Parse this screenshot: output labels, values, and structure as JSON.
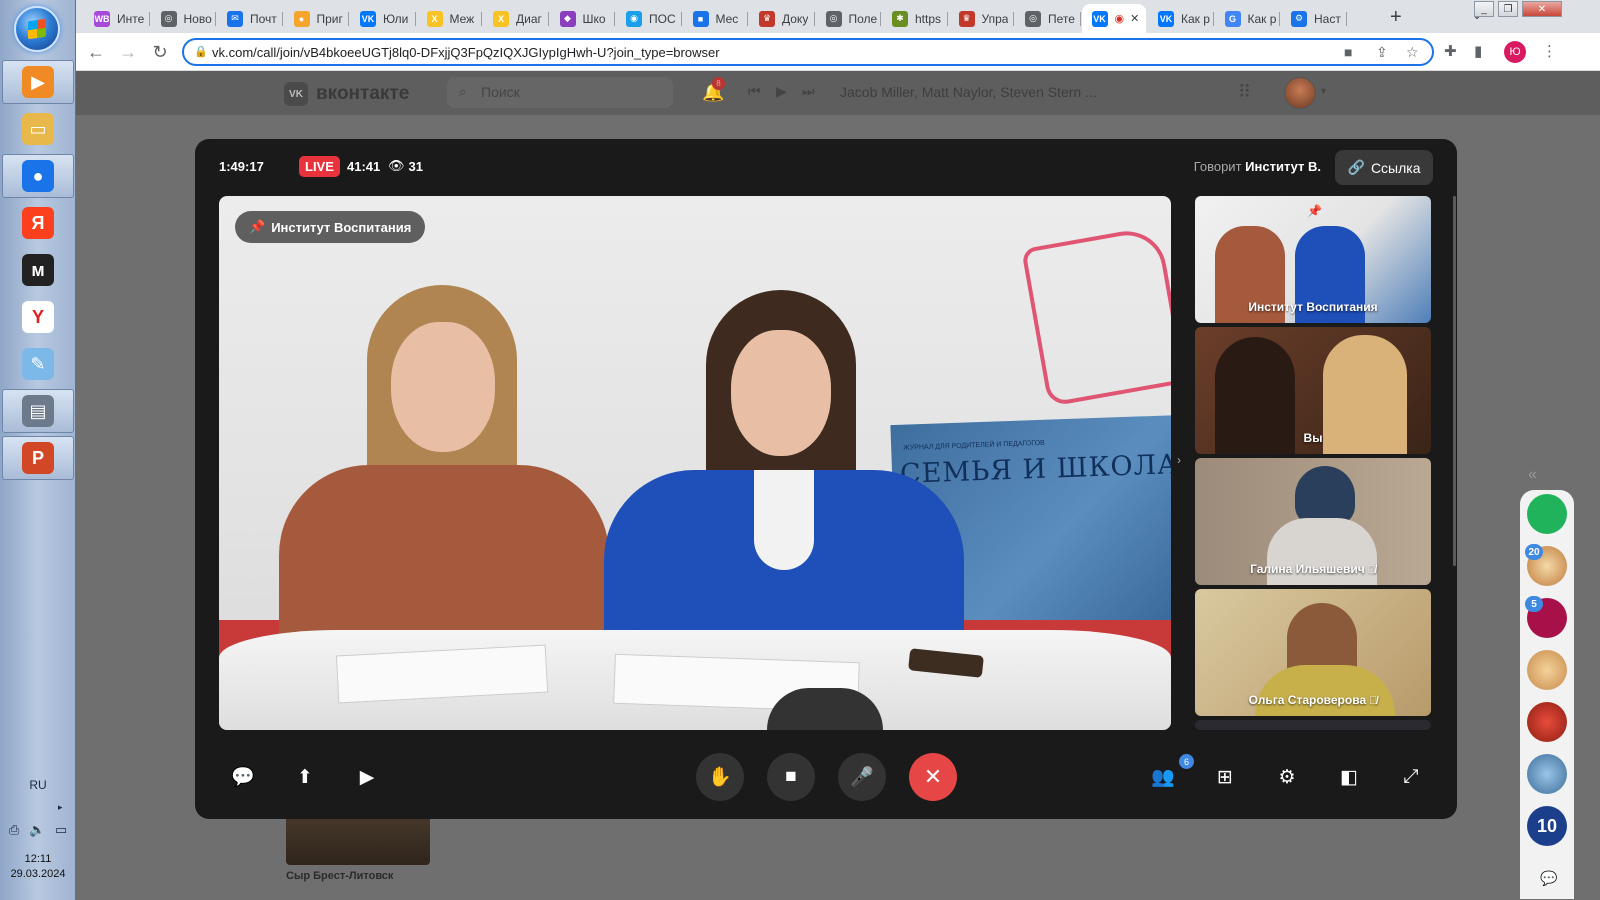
{
  "taskbar": {
    "language": "RU",
    "tray_arrow": "▸",
    "time": "12:11",
    "date": "29.03.2024",
    "apps": [
      {
        "name": "media-player",
        "color": "#f08a24",
        "glyph": "▶"
      },
      {
        "name": "file-explorer",
        "color": "#e8b84a",
        "glyph": "▭"
      },
      {
        "name": "chrome",
        "color": "#1a73e8",
        "glyph": "●"
      },
      {
        "name": "yandex",
        "color": "#fc3f1d",
        "glyph": "Я"
      },
      {
        "name": "yandex-music",
        "color": "#222",
        "glyph": "м"
      },
      {
        "name": "yandex-browser",
        "color": "#fff",
        "glyph": "Y"
      },
      {
        "name": "paint",
        "color": "#7cb9e8",
        "glyph": "✎"
      },
      {
        "name": "scanner",
        "color": "#6d7a8c",
        "glyph": "▤"
      },
      {
        "name": "powerpoint",
        "color": "#d24726",
        "glyph": "P"
      }
    ]
  },
  "browser": {
    "tabs": [
      {
        "title": "Инте",
        "favicon_color": "#a64bd9",
        "favicon_glyph": "WB"
      },
      {
        "title": "Ново",
        "favicon_color": "#5f6368",
        "favicon_glyph": "◎"
      },
      {
        "title": "Почт",
        "favicon_color": "#1a73e8",
        "favicon_glyph": "✉"
      },
      {
        "title": "Приг",
        "favicon_color": "#f4a52b",
        "favicon_glyph": "●"
      },
      {
        "title": "Юли",
        "favicon_color": "#0077ff",
        "favicon_glyph": "VK"
      },
      {
        "title": "Меж",
        "favicon_color": "#f7c325",
        "favicon_glyph": "Х"
      },
      {
        "title": "Диаг",
        "favicon_color": "#f7c325",
        "favicon_glyph": "Х"
      },
      {
        "title": "Шко",
        "favicon_color": "#8b3fbf",
        "favicon_glyph": "◆"
      },
      {
        "title": "ПОС",
        "favicon_color": "#1aa0e8",
        "favicon_glyph": "◉"
      },
      {
        "title": "Мес",
        "favicon_color": "#1a73e8",
        "favicon_glyph": "■"
      },
      {
        "title": "Доку",
        "favicon_color": "#c0392b",
        "favicon_glyph": "♛"
      },
      {
        "title": "Поле",
        "favicon_color": "#5f6368",
        "favicon_glyph": "◎"
      },
      {
        "title": "https",
        "favicon_color": "#6b8e23",
        "favicon_glyph": "✱"
      },
      {
        "title": "Упра",
        "favicon_color": "#c0392b",
        "favicon_glyph": "♛"
      },
      {
        "title": "Пете",
        "favicon_color": "#5f6368",
        "favicon_glyph": "◎"
      },
      {
        "title": "",
        "favicon_color": "#0077ff",
        "favicon_glyph": "VK",
        "active": true
      },
      {
        "title": "Как р",
        "favicon_color": "#0077ff",
        "favicon_glyph": "VK"
      },
      {
        "title": "Как р",
        "favicon_color": "#4285f4",
        "favicon_glyph": "G"
      },
      {
        "title": "Наст",
        "favicon_color": "#1a73e8",
        "favicon_glyph": "⚙"
      }
    ],
    "new_tab": "+",
    "tab_search": "⌄",
    "url": "vk.com/call/join/vB4bkoeeUGTj8lq0-DFxjjQ3FpQzIQXJGIypIgHwh-U?join_type=browser",
    "profile_initial": "Ю"
  },
  "vk": {
    "logo_mark": "VK",
    "logo_text": "вконтакте",
    "search_placeholder": "Поиск",
    "notifications_count": "8",
    "now_playing": "Jacob Miller, Matt Naylor, Steven Stern ...",
    "bg_caption": "Сыр Брест-Литовск"
  },
  "call": {
    "elapsed": "1:49:17",
    "live_label": "LIVE",
    "live_duration": "41:41",
    "viewers": "31",
    "speaking_prefix": "Говорит",
    "speaking_name": "Институт В.",
    "link_label": "Ссылка",
    "main_label": "Институт Воспитания",
    "magazine_title": "СЕМЬЯ И ШКОЛА",
    "magazine_sub": "ЖУРНАЛ ДЛЯ РОДИТЕЛЕЙ И ПЕДАГОГОВ",
    "participants_count": "6",
    "tiles": [
      {
        "name": "Институт Воспитания",
        "muted": false,
        "pinned": true
      },
      {
        "name": "Вы",
        "muted": false,
        "pinned": false
      },
      {
        "name": "Галина Ильяшевич",
        "muted": true,
        "pinned": false
      },
      {
        "name": "Ольга Староверова",
        "muted": true,
        "pinned": false
      }
    ]
  },
  "rail": {
    "items": [
      {
        "name": "whatsapp-widget",
        "badge": ""
      },
      {
        "name": "community-owl",
        "badge": "20"
      },
      {
        "name": "community-photo",
        "badge": "5"
      },
      {
        "name": "contact-1",
        "badge": ""
      },
      {
        "name": "contact-2",
        "badge": ""
      },
      {
        "name": "contact-3",
        "badge": ""
      },
      {
        "name": "channel-10",
        "badge": ""
      }
    ],
    "channel_number": "10"
  }
}
